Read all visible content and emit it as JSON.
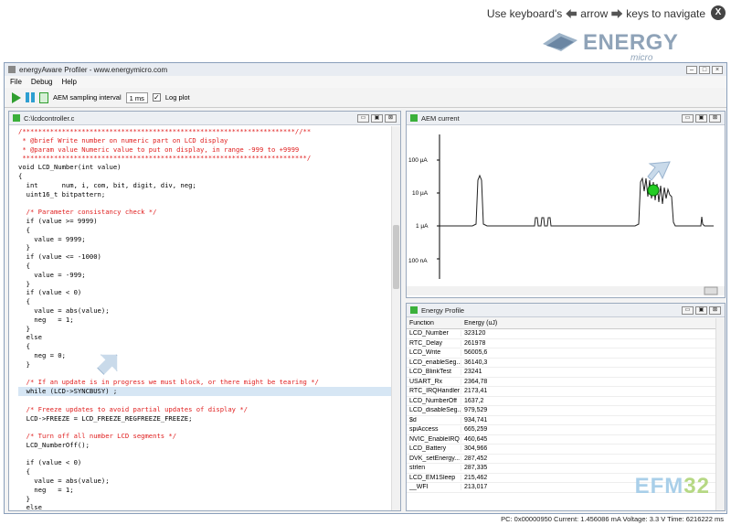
{
  "topbar": {
    "hint_before": "Use keyboard's",
    "hint_arrow": "arrow",
    "hint_after": "keys to navigate",
    "close_label": "X",
    "brand": "ENERGY",
    "brand_sub": "micro"
  },
  "window": {
    "title": "energyAware Profiler - www.energymicro.com"
  },
  "menu": [
    "File",
    "Debug",
    "Help"
  ],
  "toolbar": {
    "interval_label": "AEM sampling interval",
    "interval_value": "1 ms",
    "logplot_label": "Log plot"
  },
  "editor": {
    "title": "C:\\lcdcontroller.c",
    "lines": [
      "/*********************************************************************//**",
      " * @brief Write number on numeric part on LCD display",
      " * @param value Numeric value to put on display, in range -999 to +9999",
      " ************************************************************************/",
      "void LCD_Number(int value)",
      "{",
      "  int      num, i, com, bit, digit, div, neg;",
      "  uint16_t bitpattern;",
      "",
      "  /* Parameter consistancy check */",
      "  if (value >= 9999)",
      "  {",
      "    value = 9999;",
      "  }",
      "  if (value <= -1000)",
      "  {",
      "    value = -999;",
      "  }",
      "  if (value < 0)",
      "  {",
      "    value = abs(value);",
      "    neg   = 1;",
      "  }",
      "  else",
      "  {",
      "    neg = 0;",
      "  }",
      "",
      "  /* If an update is in progress we must block, or there might be tearing */",
      "  while (LCD->SYNCBUSY) ;",
      "",
      "  /* Freeze updates to avoid partial updates of display */",
      "  LCD->FREEZE = LCD_FREEZE_REGFREEZE_FREEZE;",
      "",
      "  /* Turn off all number LCD segments */",
      "  LCD_NumberOff();",
      "",
      "  if (value < 0)",
      "  {",
      "    value = abs(value);",
      "    neg   = 1;",
      "  }",
      "  else"
    ]
  },
  "aem": {
    "title": "AEM current",
    "yticks": [
      "100 µA",
      "10 µA",
      "1 µA",
      "100 nA"
    ]
  },
  "energy": {
    "title": "Energy Profile",
    "columns": [
      "Function",
      "Energy (uJ)"
    ],
    "rows": [
      [
        "LCD_Number",
        "323120"
      ],
      [
        "RTC_Delay",
        "261978"
      ],
      [
        "LCD_Write",
        "56005,6"
      ],
      [
        "LCD_enableSeg...",
        "36140,3"
      ],
      [
        "LCD_BlinkTest",
        "23241"
      ],
      [
        "USART_Rx",
        "2364,78"
      ],
      [
        "RTC_IRQHandler",
        "2173,41"
      ],
      [
        "LCD_NumberOff",
        "1637,2"
      ],
      [
        "LCD_disableSeg...",
        "979,529"
      ],
      [
        "$d",
        "934,741"
      ],
      [
        "spiAccess",
        "665,259"
      ],
      [
        "NVIC_EnableIRQ",
        "460,645"
      ],
      [
        "LCD_Battery",
        "304,966"
      ],
      [
        "DVK_setEnergy...",
        "287,452"
      ],
      [
        "strlen",
        "287,335"
      ],
      [
        "LCD_EM1Sleep",
        "215,462"
      ],
      [
        "__WFI",
        "213,017"
      ]
    ],
    "watermark": "EFM",
    "watermark_num": "32"
  },
  "status": "PC: 0x00000950  Current: 1.456086 mA  Voltage: 3.3 V  Time: 6216222 ms"
}
